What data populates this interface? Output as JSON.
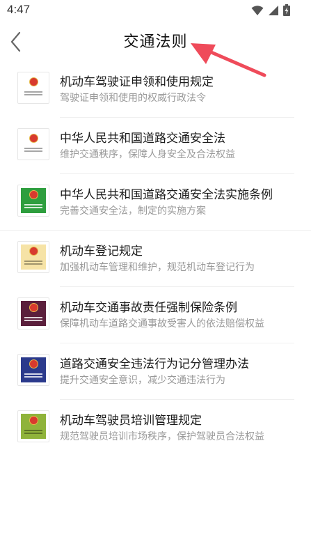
{
  "status_bar": {
    "time": "4:47"
  },
  "header": {
    "title": "交通法则"
  },
  "items": [
    {
      "title": "机动车驾驶证申领和使用规定",
      "desc": "驾驶证申领和使用的权威行政法令",
      "cover_color": "#ffffff",
      "icon": "national-emblem-icon"
    },
    {
      "title": "中华人民共和国道路交通安全法",
      "desc": "维护交通秩序，保障人身安全及合法权益",
      "cover_color": "#ffffff",
      "icon": "national-emblem-icon"
    },
    {
      "title": "中华人民共和国道路交通安全法实施条例",
      "desc": "完善交通安全法，制定的实施方案",
      "cover_color": "#2e9e3e",
      "icon": "national-emblem-icon"
    },
    {
      "title": "机动车登记规定",
      "desc": "加强机动车管理和维护，规范机动车登记行为",
      "cover_color": "#f6e3a6",
      "icon": "national-emblem-icon"
    },
    {
      "title": "机动车交通事故责任强制保险条例",
      "desc": "保障机动车道路交通事故受害人的依法赔偿权益",
      "cover_color": "#5b1f3c",
      "icon": "national-emblem-icon"
    },
    {
      "title": "道路交通安全违法行为记分管理办法",
      "desc": "提升交通安全意识，减少交通违法行为",
      "cover_color": "#2b3a8c",
      "icon": "national-emblem-icon"
    },
    {
      "title": "机动车驾驶员培训管理规定",
      "desc": "规范驾驶员培训市场秩序，保护驾驶员合法权益",
      "cover_color": "#8fb33a",
      "icon": "national-emblem-icon"
    }
  ]
}
